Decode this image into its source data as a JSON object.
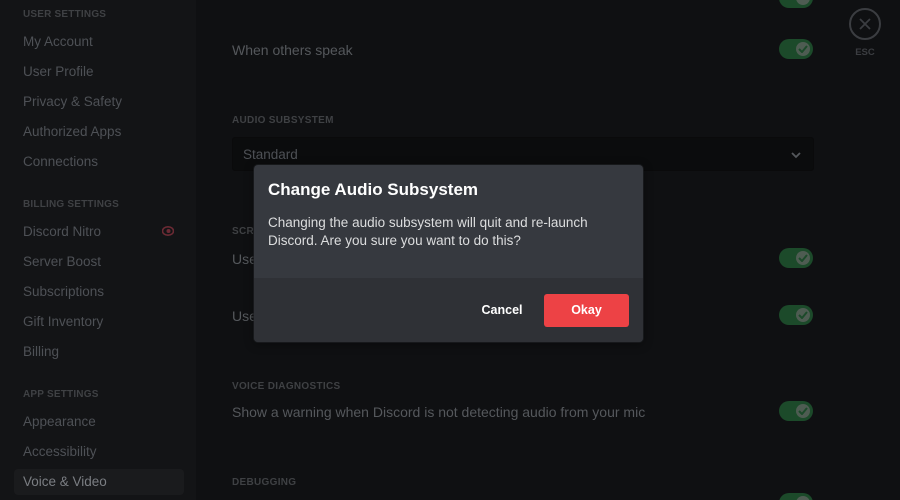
{
  "sidebar": {
    "sections": [
      {
        "heading": "User Settings",
        "items": [
          "My Account",
          "User Profile",
          "Privacy & Safety",
          "Authorized Apps",
          "Connections"
        ]
      },
      {
        "heading": "Billing Settings",
        "items": [
          "Discord Nitro",
          "Server Boost",
          "Subscriptions",
          "Gift Inventory",
          "Billing"
        ]
      },
      {
        "heading": "App Settings",
        "items": [
          "Appearance",
          "Accessibility",
          "Voice & Video"
        ]
      }
    ],
    "active_item": "Voice & Video",
    "nitro_badge_icon": "nitro-icon"
  },
  "main": {
    "when_others_speak": "When others speak",
    "audio_subsystem_heading": "Audio Subsystem",
    "audio_subsystem_value": "Standard",
    "screen_heading_partial": "Scr",
    "row1_partial": "Use",
    "row2_partial": "Use",
    "voice_diagnostics_heading": "Voice Diagnostics",
    "voice_diagnostics_text": "Show a warning when Discord is not detecting audio from your mic",
    "debugging_heading": "Debugging",
    "close_label": "ESC"
  },
  "modal": {
    "title": "Change Audio Subsystem",
    "body": "Changing the audio subsystem will quit and re-launch Discord. Are you sure you want to do this?",
    "cancel_label": "Cancel",
    "okay_label": "Okay"
  },
  "colors": {
    "okay_button": "#ed4245",
    "modal_bg": "#36393f",
    "modal_footer": "#2f3136",
    "toggle_on": "#3ba55d"
  }
}
